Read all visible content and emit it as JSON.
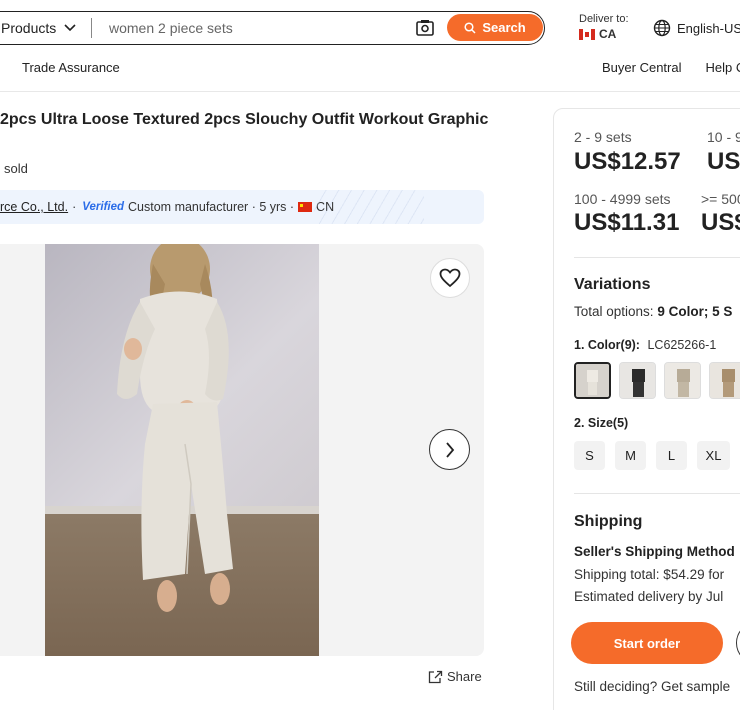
{
  "header": {
    "category_label": "Products",
    "search_placeholder": "women 2 piece sets",
    "search_button": "Search",
    "deliver_label": "Deliver to:",
    "deliver_country": "CA",
    "language": "English-US",
    "subnav_left": "Trade Assurance",
    "subnav_right": [
      "Buyer Central",
      "Help C"
    ]
  },
  "product": {
    "title": "2pcs Ultra Loose Textured 2pcs Slouchy Outfit Workout Graphic",
    "sold": "sold",
    "supplier_name": "rce Co., Ltd.",
    "verified": "Verified",
    "supplier_info": "Custom manufacturer · 5 yrs ·",
    "supplier_country": "CN",
    "share": "Share"
  },
  "pricing": {
    "tiers": [
      {
        "range": "2 - 9 sets",
        "price": "US$12.57"
      },
      {
        "range": "10 - 9",
        "price": "US"
      },
      {
        "range": "100 - 4999 sets",
        "price": "US$11.31"
      },
      {
        "range": ">= 500",
        "price": "US$"
      }
    ]
  },
  "variations": {
    "title": "Variations",
    "total_prefix": "Total options:",
    "total_value": "9 Color; 5 S",
    "color_label": "1. Color(9):",
    "color_selected": "LC625266-1",
    "size_label": "2. Size(5)",
    "sizes": [
      "S",
      "M",
      "L",
      "XL"
    ]
  },
  "shipping": {
    "title": "Shipping",
    "method": "Seller's Shipping Method",
    "total": "Shipping total: $54.29 for",
    "delivery": "Estimated delivery by Jul"
  },
  "actions": {
    "start_order": "Start order",
    "still_deciding": "Still deciding? Get sample"
  },
  "colors": {
    "accent": "#f56b2a",
    "verified": "#2a6ce8",
    "supplier_bg": "#eef4fd"
  }
}
